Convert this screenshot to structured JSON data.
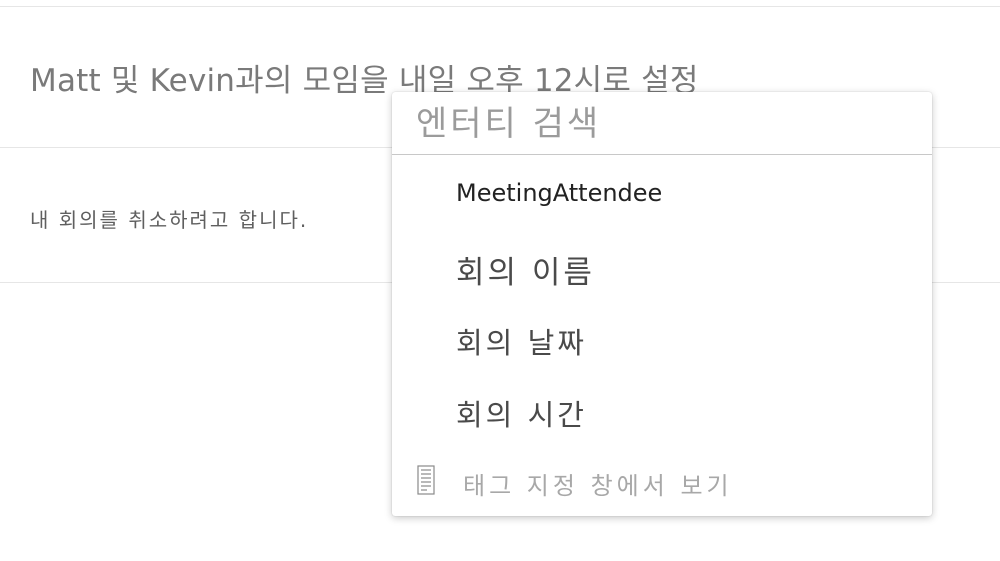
{
  "utterances": [
    "Matt 및 Kevin과의 모임을 내일 오후 12시로 설정",
    "내 회의를 취소하려고 합니다."
  ],
  "entity_popup": {
    "search_placeholder": "엔터티 검색",
    "items": [
      "MeetingAttendee",
      "회의 이름",
      "회의 날짜",
      "회의 시간"
    ],
    "footer_label": "태그 지정 창에서 보기",
    "footer_icon": "document-list-icon"
  }
}
